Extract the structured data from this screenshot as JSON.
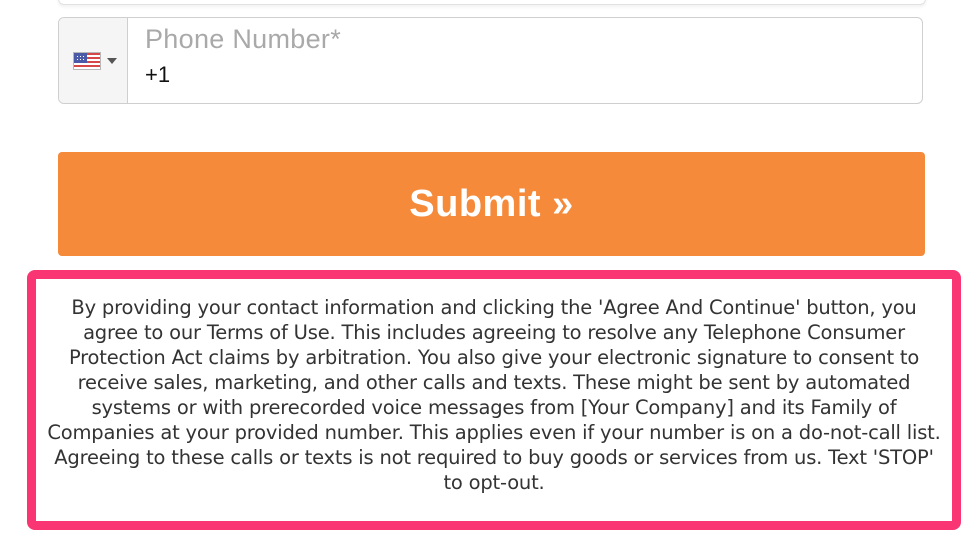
{
  "phone_field": {
    "label": "Phone Number*",
    "value": "+1",
    "country_flag": "us-flag-icon",
    "country_code": "US"
  },
  "submit": {
    "label": "Submit »"
  },
  "consent": {
    "text": "By providing your contact information and clicking the 'Agree And Continue' button, you agree to our Terms of Use. This includes agreeing to resolve any Telephone Consumer Protection Act claims by arbitration. You also give your electronic signature to consent to receive sales, marketing, and other calls and texts. These might be sent by automated systems or with prerecorded voice messages from [Your Company] and its Family of Companies at your provided number. This applies even if your number is on a do-not-call list. Agreeing to these calls or texts is not required to buy goods or services from us. Text 'STOP' to opt-out.",
    "highlight_color": "#f93573"
  },
  "colors": {
    "submit_bg": "#f58a3a",
    "submit_text": "#ffffff",
    "label_gray": "#a9a9a9"
  }
}
